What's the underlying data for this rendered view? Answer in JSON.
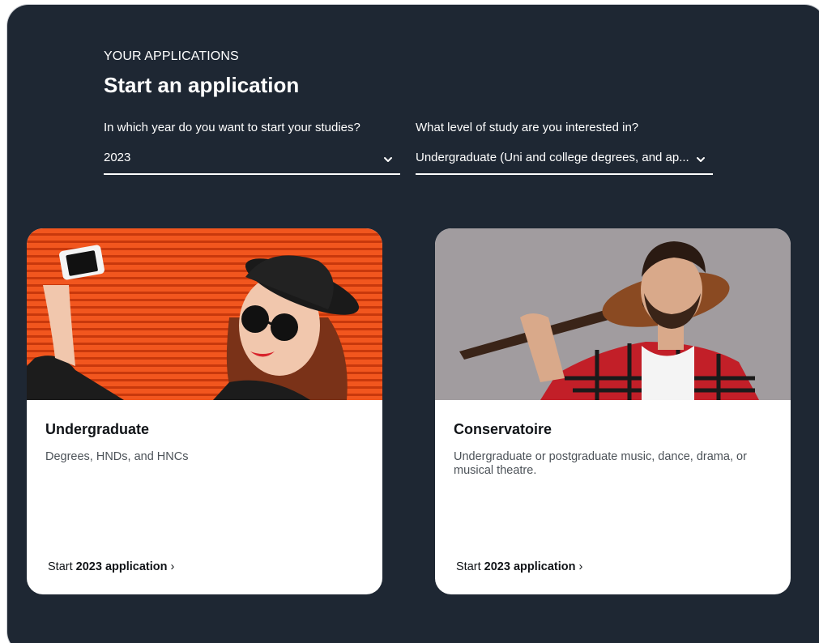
{
  "header": {
    "eyebrow": "YOUR APPLICATIONS",
    "title": "Start an application"
  },
  "filters": {
    "year": {
      "label": "In which year do you want to start your studies?",
      "value": "2023"
    },
    "level": {
      "label": "What level of study are you interested in?",
      "value": "Undergraduate (Uni and college degrees, and ap..."
    }
  },
  "cards": [
    {
      "title": "Undergraduate",
      "description": "Degrees, HNDs, and HNCs",
      "cta_prefix": "Start",
      "cta_bold": "2023 application",
      "cta_suffix": "›"
    },
    {
      "title": "Conservatoire",
      "description": "Undergraduate or postgraduate music, dance, drama, or musical theatre.",
      "cta_prefix": "Start",
      "cta_bold": "2023 application",
      "cta_suffix": "›"
    }
  ],
  "colors": {
    "panel_bg": "#1e2733",
    "card_bg": "#ffffff",
    "accent_orange": "#f4541c"
  },
  "icons": {
    "select_arrow": "chevron-down-icon"
  }
}
